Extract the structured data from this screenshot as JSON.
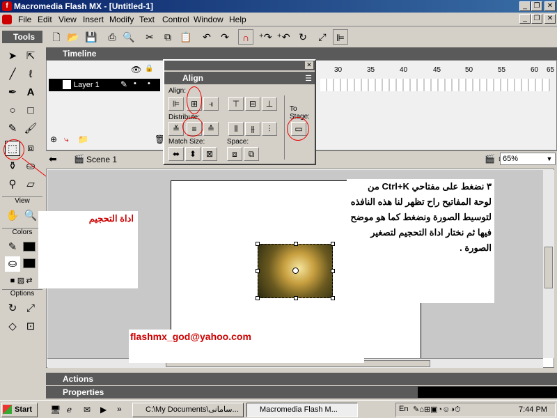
{
  "window": {
    "title": "Macromedia Flash MX - [Untitled-1]"
  },
  "menu": [
    "File",
    "Edit",
    "View",
    "Insert",
    "Modify",
    "Text",
    "Control",
    "Window",
    "Help"
  ],
  "tools": {
    "title": "Tools",
    "sections": {
      "view": "View",
      "colors": "Colors",
      "options": "Options"
    }
  },
  "timeline": {
    "title": "Timeline",
    "layer_name": "Layer 1",
    "frame_numbers": [
      "30",
      "35",
      "40",
      "45",
      "50",
      "55",
      "60",
      "65"
    ]
  },
  "scene": {
    "name": "Scene 1",
    "zoom": "65%"
  },
  "align_panel": {
    "title": "Align",
    "align_label": "Align:",
    "distribute_label": "Distribute:",
    "match_size_label": "Match Size:",
    "space_label": "Space:",
    "to_stage_label": "To Stage:"
  },
  "annotations": {
    "step_text": "٣ نضغط على مفتاحي Ctrl+K من لوحة المفاتيح راح تظهر لنا هذه النافذه لتوسيط الصورة ونضغط كما هو موضح فيها ثم نختار اداة التحجيم لتصغير الصورة .",
    "tool_label": "اداة التحجيم",
    "email": "flashmx_god@yahoo.com"
  },
  "panels": {
    "actions": "Actions",
    "properties": "Properties"
  },
  "taskbar": {
    "start": "Start",
    "task1": "C:\\My Documents\\سامانی...",
    "task2": "Macromedia Flash M...",
    "lang": "En",
    "clock": "7:44 PM"
  }
}
